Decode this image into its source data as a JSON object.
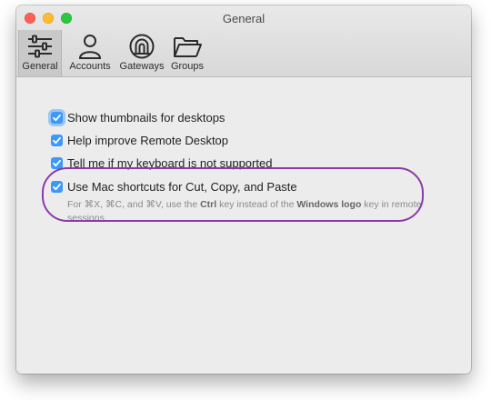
{
  "window": {
    "title": "General"
  },
  "toolbar": {
    "tabs": [
      {
        "label": "General",
        "icon": "sliders-icon",
        "active": true
      },
      {
        "label": "Accounts",
        "icon": "person-icon",
        "active": false
      },
      {
        "label": "Gateways",
        "icon": "gateway-icon",
        "active": false
      },
      {
        "label": "Groups",
        "icon": "folder-icon",
        "active": false
      }
    ]
  },
  "options": [
    {
      "label": "Show thumbnails for desktops",
      "checked": true
    },
    {
      "label": "Help improve Remote Desktop",
      "checked": true
    },
    {
      "label": "Tell me if my keyboard is not supported",
      "checked": true
    },
    {
      "label": "Use Mac shortcuts for Cut, Copy, and Paste",
      "checked": true
    }
  ],
  "shortcut_note": {
    "part1": "For ⌘X, ⌘C, and ⌘V, use the ",
    "key1": "Ctrl",
    "part2": " key instead of the ",
    "key2": "Windows logo",
    "part3": " key in remote sessions."
  },
  "colors": {
    "checkbox": "#3b99fc",
    "highlight": "#8b3aa9"
  }
}
